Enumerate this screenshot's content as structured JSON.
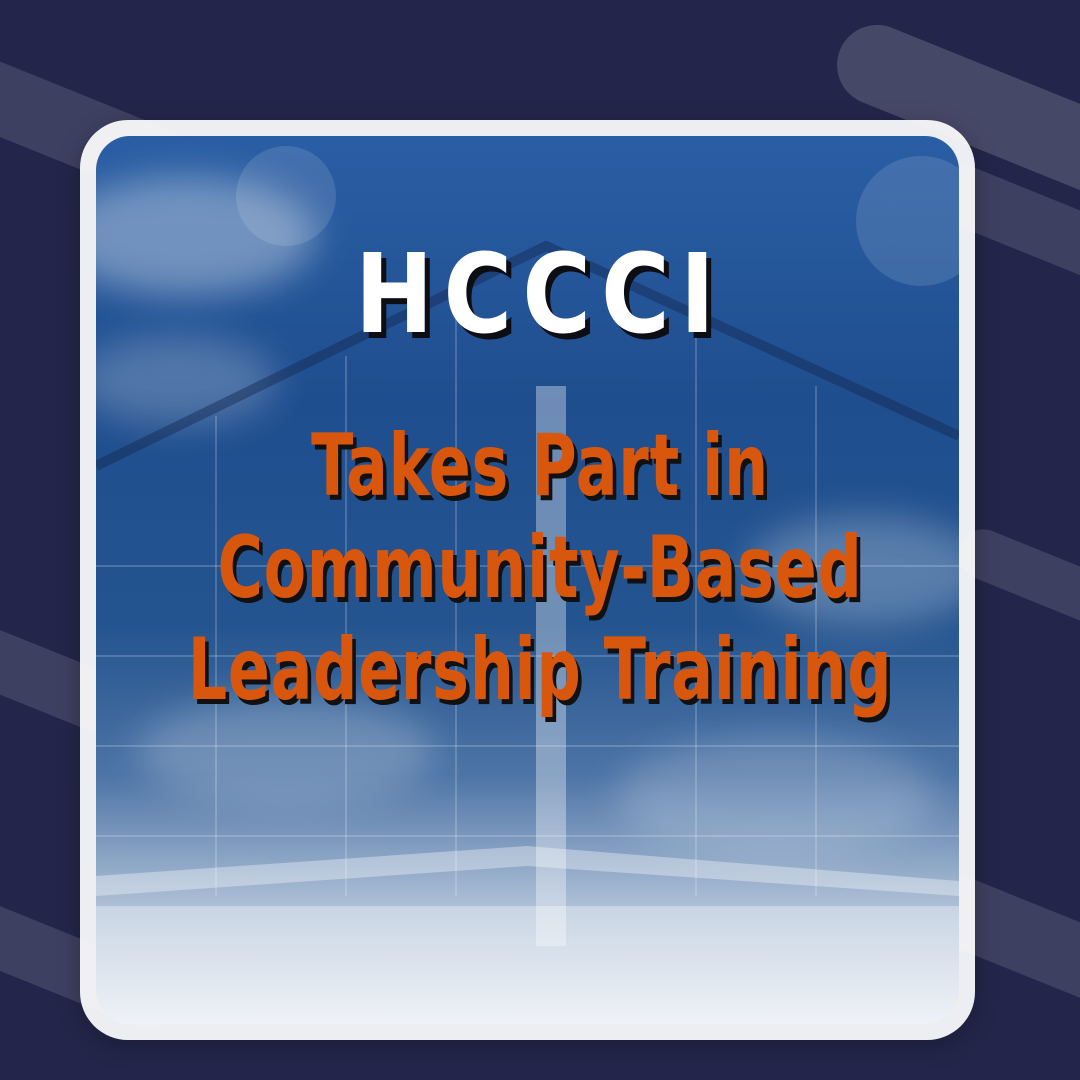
{
  "brand": "HCCCI",
  "subtitle_lines": [
    "Takes Part in",
    "Community-Based",
    "Leadership Training"
  ],
  "colors": {
    "background": "#23264a",
    "brand_text": "#ffffff",
    "subtitle_text": "#d9570d",
    "frame": "#ffffff",
    "sky": "#1f4e8f"
  }
}
